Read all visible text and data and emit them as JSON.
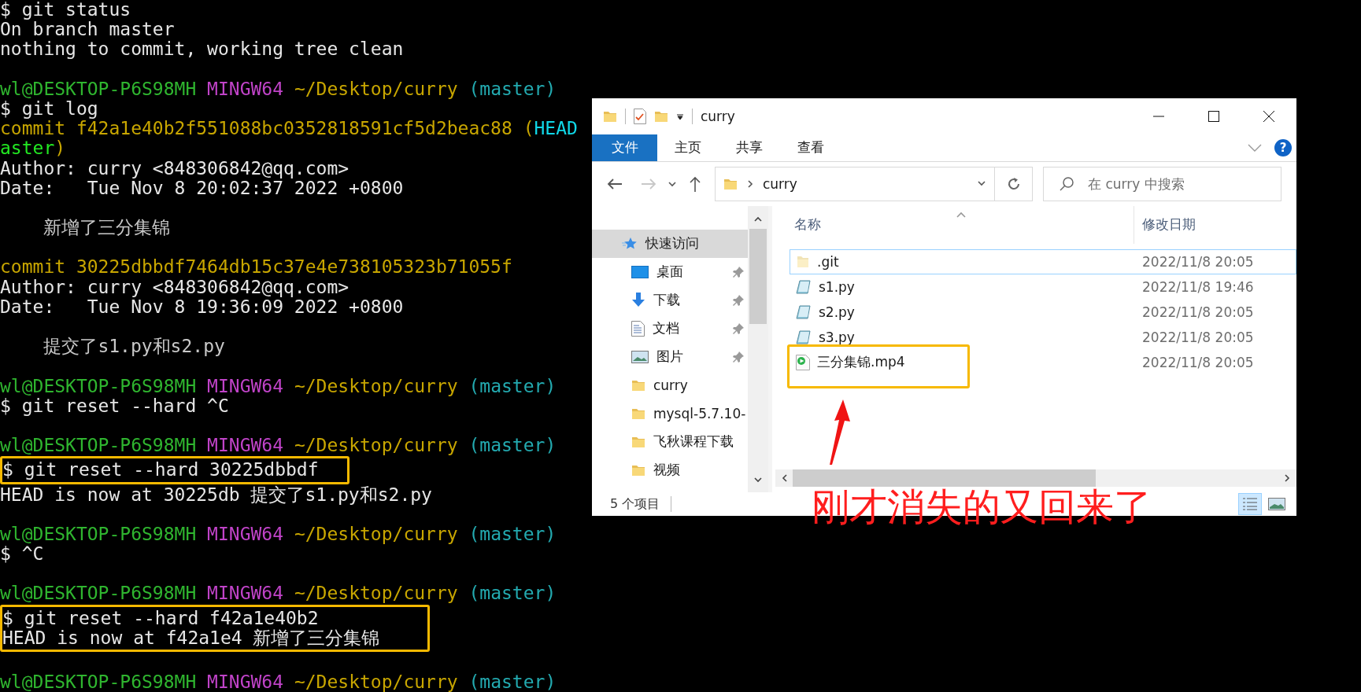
{
  "terminal": {
    "lines": [
      {
        "kind": "text",
        "segments": [
          {
            "kind": "plain",
            "text": "$ git status"
          }
        ]
      },
      {
        "kind": "text",
        "segments": [
          {
            "kind": "plain",
            "text": "On branch master"
          }
        ]
      },
      {
        "kind": "text",
        "segments": [
          {
            "kind": "plain",
            "text": "nothing to commit, working tree clean"
          }
        ]
      },
      {
        "kind": "blank"
      },
      {
        "kind": "text",
        "segments": [
          {
            "kind": "user",
            "text": "wl@DESKTOP-P6S98MH"
          },
          {
            "kind": "shell",
            "text": "MINGW64"
          },
          {
            "kind": "path",
            "text": "~/Desktop/curry"
          },
          {
            "kind": "branch",
            "text": "(master)"
          }
        ]
      },
      {
        "kind": "text",
        "segments": [
          {
            "kind": "plain",
            "text": "$ git log"
          }
        ]
      },
      {
        "kind": "text",
        "segments": [
          {
            "kind": "commit",
            "text": "commit f42a1e40b2f551088bc0352818591cf5d2beac88 ("
          },
          {
            "kind": "head",
            "text": "HEAD",
            "attach": true
          }
        ]
      },
      {
        "kind": "text",
        "segments": [
          {
            "kind": "ref",
            "text": "aster"
          },
          {
            "kind": "commit",
            "text": ")",
            "attach": true
          }
        ]
      },
      {
        "kind": "text",
        "segments": [
          {
            "kind": "plain",
            "text": "Author: curry <848306842@qq.com>"
          }
        ]
      },
      {
        "kind": "text",
        "segments": [
          {
            "kind": "plain",
            "text": "Date:   Tue Nov 8 20:02:37 2022 +0800"
          }
        ]
      },
      {
        "kind": "blank"
      },
      {
        "kind": "text",
        "segments": [
          {
            "kind": "message",
            "text": "新增了三分集锦"
          }
        ]
      },
      {
        "kind": "blank"
      },
      {
        "kind": "text",
        "segments": [
          {
            "kind": "commit",
            "text": "commit 30225dbbdf7464db15c37e4e738105323b71055f"
          }
        ]
      },
      {
        "kind": "text",
        "segments": [
          {
            "kind": "plain",
            "text": "Author: curry <848306842@qq.com>"
          }
        ]
      },
      {
        "kind": "text",
        "segments": [
          {
            "kind": "plain",
            "text": "Date:   Tue Nov 8 19:36:09 2022 +0800"
          }
        ]
      },
      {
        "kind": "blank"
      },
      {
        "kind": "text",
        "segments": [
          {
            "kind": "message",
            "text": "提交了s1.py和s2.py"
          }
        ]
      },
      {
        "kind": "blank"
      },
      {
        "kind": "text",
        "segments": [
          {
            "kind": "user",
            "text": "wl@DESKTOP-P6S98MH"
          },
          {
            "kind": "shell",
            "text": "MINGW64"
          },
          {
            "kind": "path",
            "text": "~/Desktop/curry"
          },
          {
            "kind": "branch",
            "text": "(master)"
          }
        ]
      },
      {
        "kind": "text",
        "segments": [
          {
            "kind": "plain",
            "text": "$ git reset --hard ^C"
          }
        ]
      },
      {
        "kind": "blank"
      },
      {
        "kind": "text",
        "segments": [
          {
            "kind": "user",
            "text": "wl@DESKTOP-P6S98MH"
          },
          {
            "kind": "shell",
            "text": "MINGW64"
          },
          {
            "kind": "path",
            "text": "~/Desktop/curry"
          },
          {
            "kind": "branch",
            "text": "(master)"
          }
        ]
      },
      {
        "kind": "boxed",
        "lines": [
          {
            "kind": "text",
            "segments": [
              {
                "kind": "plain",
                "text": "$ git reset --hard 30225dbbdf"
              }
            ]
          }
        ]
      },
      {
        "kind": "text",
        "segments": [
          {
            "kind": "plain",
            "text": "HEAD is now at 30225db 提交了s1.py和s2.py"
          }
        ]
      },
      {
        "kind": "blank"
      },
      {
        "kind": "text",
        "segments": [
          {
            "kind": "user",
            "text": "wl@DESKTOP-P6S98MH"
          },
          {
            "kind": "shell",
            "text": "MINGW64"
          },
          {
            "kind": "path",
            "text": "~/Desktop/curry"
          },
          {
            "kind": "branch",
            "text": "(master)"
          }
        ]
      },
      {
        "kind": "text",
        "segments": [
          {
            "kind": "plain",
            "text": "$ ^C"
          }
        ]
      },
      {
        "kind": "blank"
      },
      {
        "kind": "text",
        "segments": [
          {
            "kind": "user",
            "text": "wl@DESKTOP-P6S98MH"
          },
          {
            "kind": "shell",
            "text": "MINGW64"
          },
          {
            "kind": "path",
            "text": "~/Desktop/curry"
          },
          {
            "kind": "branch",
            "text": "(master)"
          }
        ]
      },
      {
        "kind": "boxed",
        "lines": [
          {
            "kind": "text",
            "segments": [
              {
                "kind": "plain",
                "text": "$ git reset --hard f42a1e40b2"
              }
            ]
          },
          {
            "kind": "text",
            "segments": [
              {
                "kind": "plain",
                "text": "HEAD is now at f42a1e4 新增了三分集锦"
              }
            ]
          }
        ]
      },
      {
        "kind": "blank"
      },
      {
        "kind": "text",
        "segments": [
          {
            "kind": "user",
            "text": "wl@DESKTOP-P6S98MH"
          },
          {
            "kind": "shell",
            "text": "MINGW64"
          },
          {
            "kind": "path",
            "text": "~/Desktop/curry"
          },
          {
            "kind": "branch",
            "text": "(master)"
          }
        ]
      }
    ]
  },
  "explorer": {
    "title": "curry",
    "ribbon_tabs": [
      {
        "label": "文件",
        "selected": true
      },
      {
        "label": "主页",
        "selected": false
      },
      {
        "label": "共享",
        "selected": false
      },
      {
        "label": "查看",
        "selected": false
      }
    ],
    "help": "?",
    "address": {
      "crumb": "curry"
    },
    "search": {
      "placeholder": "在 curry 中搜索"
    },
    "nav_items": [
      {
        "kind": "star",
        "label": "快速访问",
        "selected": true,
        "pinned": false
      },
      {
        "kind": "desktop",
        "label": "桌面",
        "selected": false,
        "pinned": true
      },
      {
        "kind": "download",
        "label": "下载",
        "selected": false,
        "pinned": true
      },
      {
        "kind": "document",
        "label": "文档",
        "selected": false,
        "pinned": true
      },
      {
        "kind": "picture",
        "label": "图片",
        "selected": false,
        "pinned": true
      },
      {
        "kind": "folder",
        "label": "curry",
        "selected": false,
        "pinned": false
      },
      {
        "kind": "folder",
        "label": "mysql-5.7.10-",
        "selected": false,
        "pinned": false
      },
      {
        "kind": "folder",
        "label": "飞秋课程下载",
        "selected": false,
        "pinned": false
      },
      {
        "kind": "folder",
        "label": "视频",
        "selected": false,
        "pinned": false
      }
    ],
    "columns": [
      "名称",
      "修改日期"
    ],
    "files": [
      {
        "kind": "folder",
        "name": ".git",
        "date": "2022/11/8 20:05",
        "selected": true,
        "highlighted": false
      },
      {
        "kind": "python",
        "name": "s1.py",
        "date": "2022/11/8 19:46",
        "selected": false,
        "highlighted": false
      },
      {
        "kind": "python",
        "name": "s2.py",
        "date": "2022/11/8 20:05",
        "selected": false,
        "highlighted": false
      },
      {
        "kind": "python",
        "name": "s3.py",
        "date": "2022/11/8 20:05",
        "selected": false,
        "highlighted": false
      },
      {
        "kind": "video",
        "name": "三分集锦.mp4",
        "date": "2022/11/8 20:05",
        "selected": false,
        "highlighted": true
      }
    ],
    "status": "5 个项目",
    "views": [
      {
        "kind": "details",
        "selected": true
      },
      {
        "kind": "tiles",
        "selected": false
      }
    ]
  },
  "annotation": {
    "text": "刚才消失的又回来了"
  }
}
